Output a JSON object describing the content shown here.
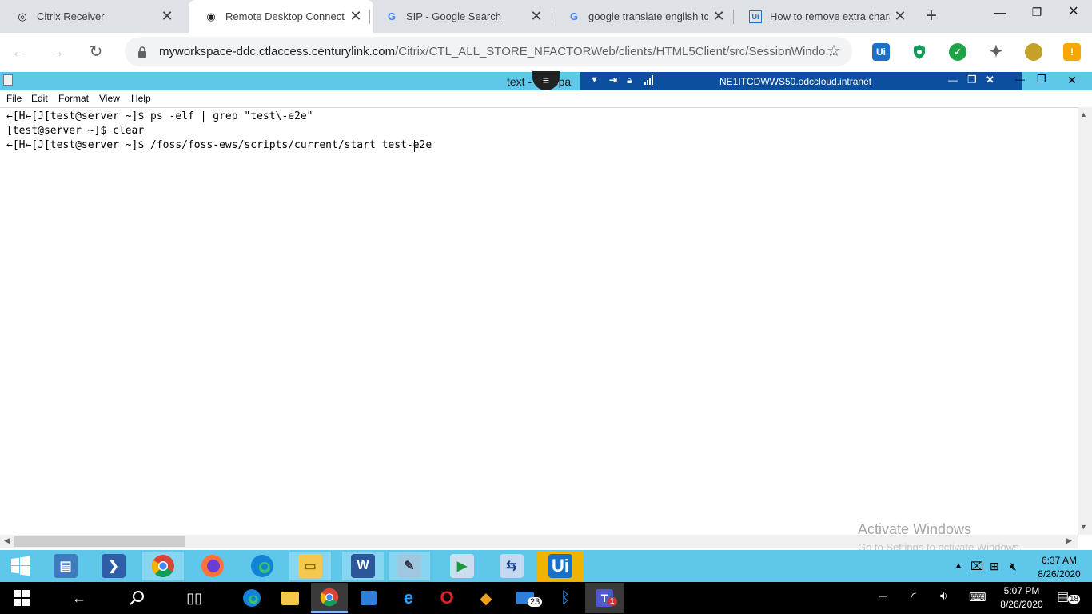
{
  "tabs": [
    {
      "title": "Citrix Receiver",
      "icon": "citrix-icon"
    },
    {
      "title": "Remote Desktop Connection",
      "icon": "globe-icon"
    },
    {
      "title": "SIP - Google Search",
      "icon": "google-icon"
    },
    {
      "title": "google translate english to t",
      "icon": "google-icon"
    },
    {
      "title": "How to remove extra charac",
      "icon": "uipath-icon"
    }
  ],
  "address": {
    "domain": "myworkspace-ddc.ctlaccess.centurylink.com",
    "path": "/Citrix/CTL_ALL_STORE_NFACTORWeb/clients/HTML5Client/src/SessionWindo..."
  },
  "extensions": {
    "uipath": "Ui",
    "alert": "!"
  },
  "citrix": {
    "notepad_title": "text - Notepa",
    "host": "NE1ITCDWWS50.odccloud.intranet"
  },
  "menu": [
    "File",
    "Edit",
    "Format",
    "View",
    "Help"
  ],
  "editor": {
    "lines": [
      "←[H←[J[test@server ~]$ ps -elf | grep \"test\\-e2e\"",
      "[test@server ~]$ clear",
      "←[H←[J[test@server ~]$ /foss/foss-ews/scripts/current/start test-e2e"
    ]
  },
  "watermark": {
    "title": "Activate Windows",
    "subtitle": "Go to Settings to activate Windows."
  },
  "remote_taskbar": {
    "apps": [
      "start",
      "server-manager",
      "powershell",
      "chrome",
      "firefox",
      "edge",
      "file-explorer",
      "word",
      "notepad",
      "remote-app",
      "network",
      "uipath"
    ],
    "uipath_label": "Ui",
    "time": "6:37 AM",
    "date": "8/26/2020"
  },
  "local_taskbar": {
    "mail_badge": "23",
    "teams_badge": "1",
    "time": "5:07 PM",
    "date": "8/26/2020",
    "notifications": "18"
  }
}
